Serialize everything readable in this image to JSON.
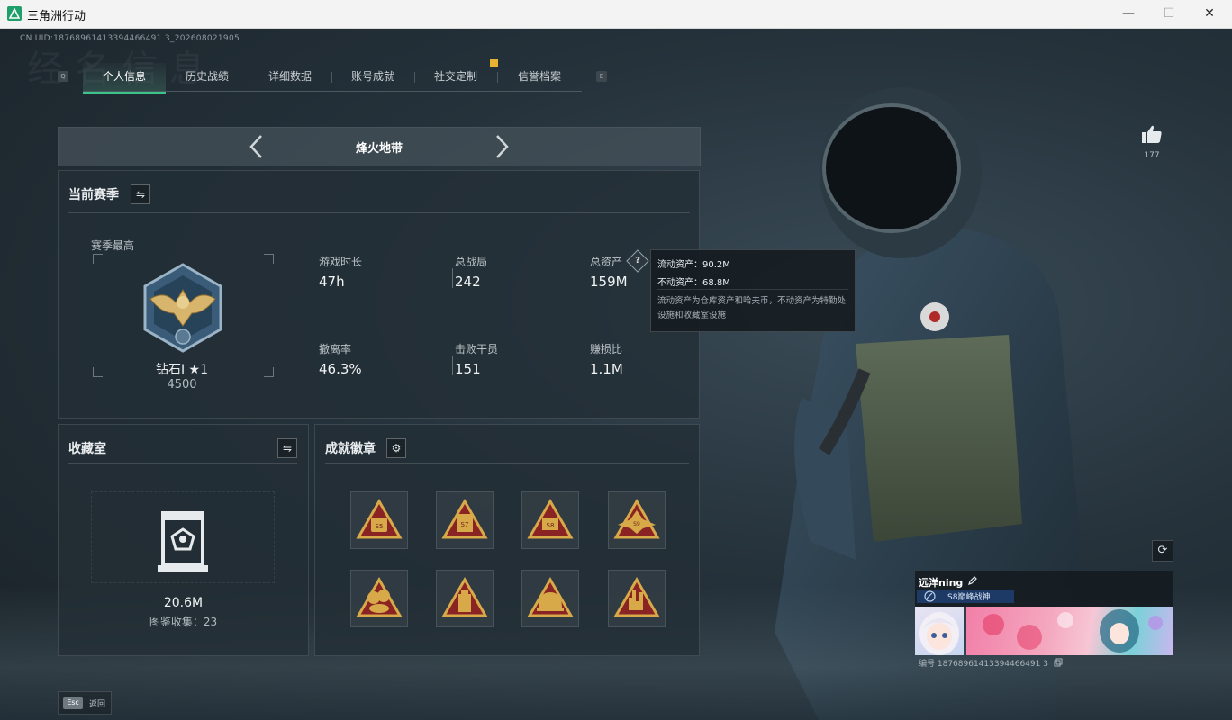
{
  "window": {
    "title": "三角洲行动",
    "minimize": "—",
    "maximize": "☐",
    "close": "✕"
  },
  "uid_text": "CN UID:18768961413394466491 3_202608021905",
  "bg_title": "经 名 信 息",
  "tabs": {
    "left_key": "Q",
    "right_key": "E",
    "items": [
      {
        "label": "个人信息",
        "active": true
      },
      {
        "label": "历史战绩"
      },
      {
        "label": "详细数据"
      },
      {
        "label": "账号成就"
      },
      {
        "label": "社交定制",
        "notice": "!"
      },
      {
        "label": "信誉档案"
      }
    ]
  },
  "mode": {
    "title": "烽火地带"
  },
  "current_season": {
    "title": "当前赛季",
    "best_label": "赛季最高",
    "rank_name": "钻石I ★1",
    "rank_score": "4500",
    "stats": [
      {
        "label": "游戏时长",
        "value": "47h"
      },
      {
        "label": "总战局",
        "value": "242"
      },
      {
        "label": "总资产",
        "value": "159M"
      },
      {
        "label": "撤离率",
        "value": "46.3%"
      },
      {
        "label": "击败干员",
        "value": "151"
      },
      {
        "label": "赚损比",
        "value": "1.1M"
      }
    ]
  },
  "tooltip": {
    "line1": "流动资产：90.2M",
    "line2": "不动资产：68.8M",
    "desc": "流动资产为仓库资产和哈夫币，不动资产为特勤处设施和收藏室设施"
  },
  "collection": {
    "title": "收藏室",
    "value": "20.6M",
    "count": "图鉴收集：23"
  },
  "badges": {
    "title": "成就徽章"
  },
  "like": {
    "count": "177"
  },
  "card": {
    "name": "远洋ning",
    "title": "S8巅峰战神",
    "id": "编号 18768961413394466491 3"
  },
  "esc": {
    "key": "Esc",
    "label": "返回"
  }
}
